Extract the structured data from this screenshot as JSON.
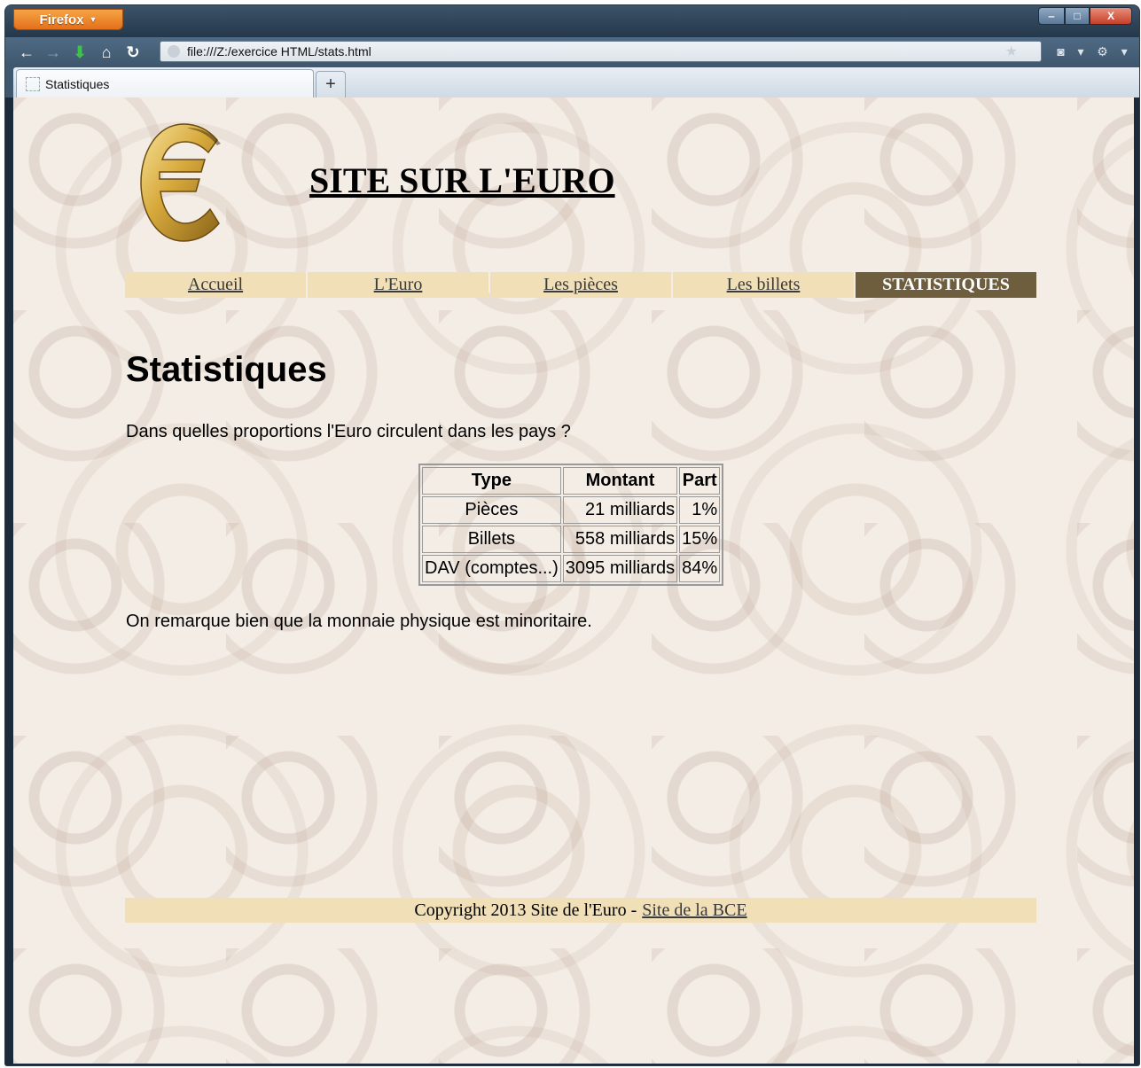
{
  "browser": {
    "app_button": "Firefox",
    "url": "file:///Z:/exercice HTML/stats.html",
    "tab_title": "Statistiques",
    "new_tab": "+",
    "win_min": "‒",
    "win_max": "□",
    "win_close": "X"
  },
  "site": {
    "title": "SITE SUR L'EURO",
    "logo_glyph": "€"
  },
  "menu": {
    "items": [
      {
        "label": "Accueil"
      },
      {
        "label": "L'Euro"
      },
      {
        "label": "Les pièces"
      },
      {
        "label": "Les billets"
      },
      {
        "label": "STATISTIQUES"
      }
    ]
  },
  "main": {
    "heading": "Statistiques",
    "intro": "Dans quelles proportions l'Euro circulent dans les pays ?",
    "table": {
      "headers": [
        "Type",
        "Montant",
        "Part"
      ],
      "rows": [
        [
          "Pièces",
          "21 milliards",
          "1%"
        ],
        [
          "Billets",
          "558 milliards",
          "15%"
        ],
        [
          "DAV (comptes...)",
          "3095 milliards",
          "84%"
        ]
      ]
    },
    "outro": "On remarque bien que la monnaie physique est minoritaire."
  },
  "footer": {
    "text": "Copyright 2013 Site de l'Euro -",
    "link": "Site de la BCE"
  },
  "colors": {
    "menu_bg": "#f1dfb8",
    "menu_active_bg": "#6e5e3e",
    "firefox_orange": "#e3701a"
  }
}
